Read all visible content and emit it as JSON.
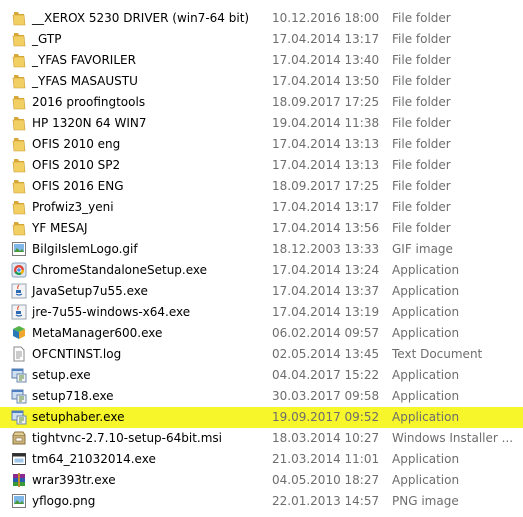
{
  "files": [
    {
      "name": "__XEROX 5230 DRIVER (win7-64 bit)",
      "date": "10.12.2016 18:00",
      "type": "File folder",
      "icon": "folder-icon"
    },
    {
      "name": "_GTP",
      "date": "17.04.2014 13:17",
      "type": "File folder",
      "icon": "folder-icon"
    },
    {
      "name": "_YFAS FAVORILER",
      "date": "17.04.2014 13:40",
      "type": "File folder",
      "icon": "folder-icon"
    },
    {
      "name": "_YFAS MASAUSTU",
      "date": "17.04.2014 13:50",
      "type": "File folder",
      "icon": "folder-icon"
    },
    {
      "name": "2016 proofingtools",
      "date": "18.09.2017 17:25",
      "type": "File folder",
      "icon": "folder-icon"
    },
    {
      "name": "HP 1320N 64 WIN7",
      "date": "19.04.2014 11:38",
      "type": "File folder",
      "icon": "folder-icon"
    },
    {
      "name": "OFIS 2010 eng",
      "date": "17.04.2014 13:13",
      "type": "File folder",
      "icon": "folder-icon"
    },
    {
      "name": "OFIS 2010 SP2",
      "date": "17.04.2014 13:13",
      "type": "File folder",
      "icon": "folder-icon"
    },
    {
      "name": "OFIS 2016 ENG",
      "date": "18.09.2017 17:25",
      "type": "File folder",
      "icon": "folder-icon"
    },
    {
      "name": "Profwiz3_yeni",
      "date": "17.04.2014 13:17",
      "type": "File folder",
      "icon": "folder-icon"
    },
    {
      "name": "YF MESAJ",
      "date": "17.04.2014 13:56",
      "type": "File folder",
      "icon": "folder-icon"
    },
    {
      "name": "BilgiIslemLogo.gif",
      "date": "18.12.2003 13:33",
      "type": "GIF image",
      "icon": "image-file-icon"
    },
    {
      "name": "ChromeStandaloneSetup.exe",
      "date": "17.04.2014 13:24",
      "type": "Application",
      "icon": "chrome-setup-icon"
    },
    {
      "name": "JavaSetup7u55.exe",
      "date": "17.04.2014 13:37",
      "type": "Application",
      "icon": "java-icon"
    },
    {
      "name": "jre-7u55-windows-x64.exe",
      "date": "17.04.2014 13:19",
      "type": "Application",
      "icon": "java-icon"
    },
    {
      "name": "MetaManager600.exe",
      "date": "06.02.2014 09:57",
      "type": "Application",
      "icon": "metamanager-icon"
    },
    {
      "name": "OFCNTINST.log",
      "date": "02.05.2014 13:45",
      "type": "Text Document",
      "icon": "text-document-icon"
    },
    {
      "name": "setup.exe",
      "date": "04.04.2017 15:22",
      "type": "Application",
      "icon": "setup-icon"
    },
    {
      "name": "setup718.exe",
      "date": "30.03.2017 09:58",
      "type": "Application",
      "icon": "setup-icon"
    },
    {
      "name": "setuphaber.exe",
      "date": "19.09.2017 09:52",
      "type": "Application",
      "icon": "setup-icon",
      "selected": true
    },
    {
      "name": "tightvnc-2.7.10-setup-64bit.msi",
      "date": "18.03.2014 10:27",
      "type": "Windows Installer ...",
      "icon": "installer-package-icon"
    },
    {
      "name": "tm64_21032014.exe",
      "date": "21.03.2014 11:01",
      "type": "Application",
      "icon": "application-window-icon"
    },
    {
      "name": "wrar393tr.exe",
      "date": "04.05.2010 18:27",
      "type": "Application",
      "icon": "winrar-icon"
    },
    {
      "name": "yflogo.png",
      "date": "22.01.2013 14:57",
      "type": "PNG image",
      "icon": "image-file-icon"
    }
  ],
  "colors": {
    "selection_highlight": "#f6f62a",
    "secondary_text": "#6d6d6d",
    "folder": "#e9c04a"
  }
}
